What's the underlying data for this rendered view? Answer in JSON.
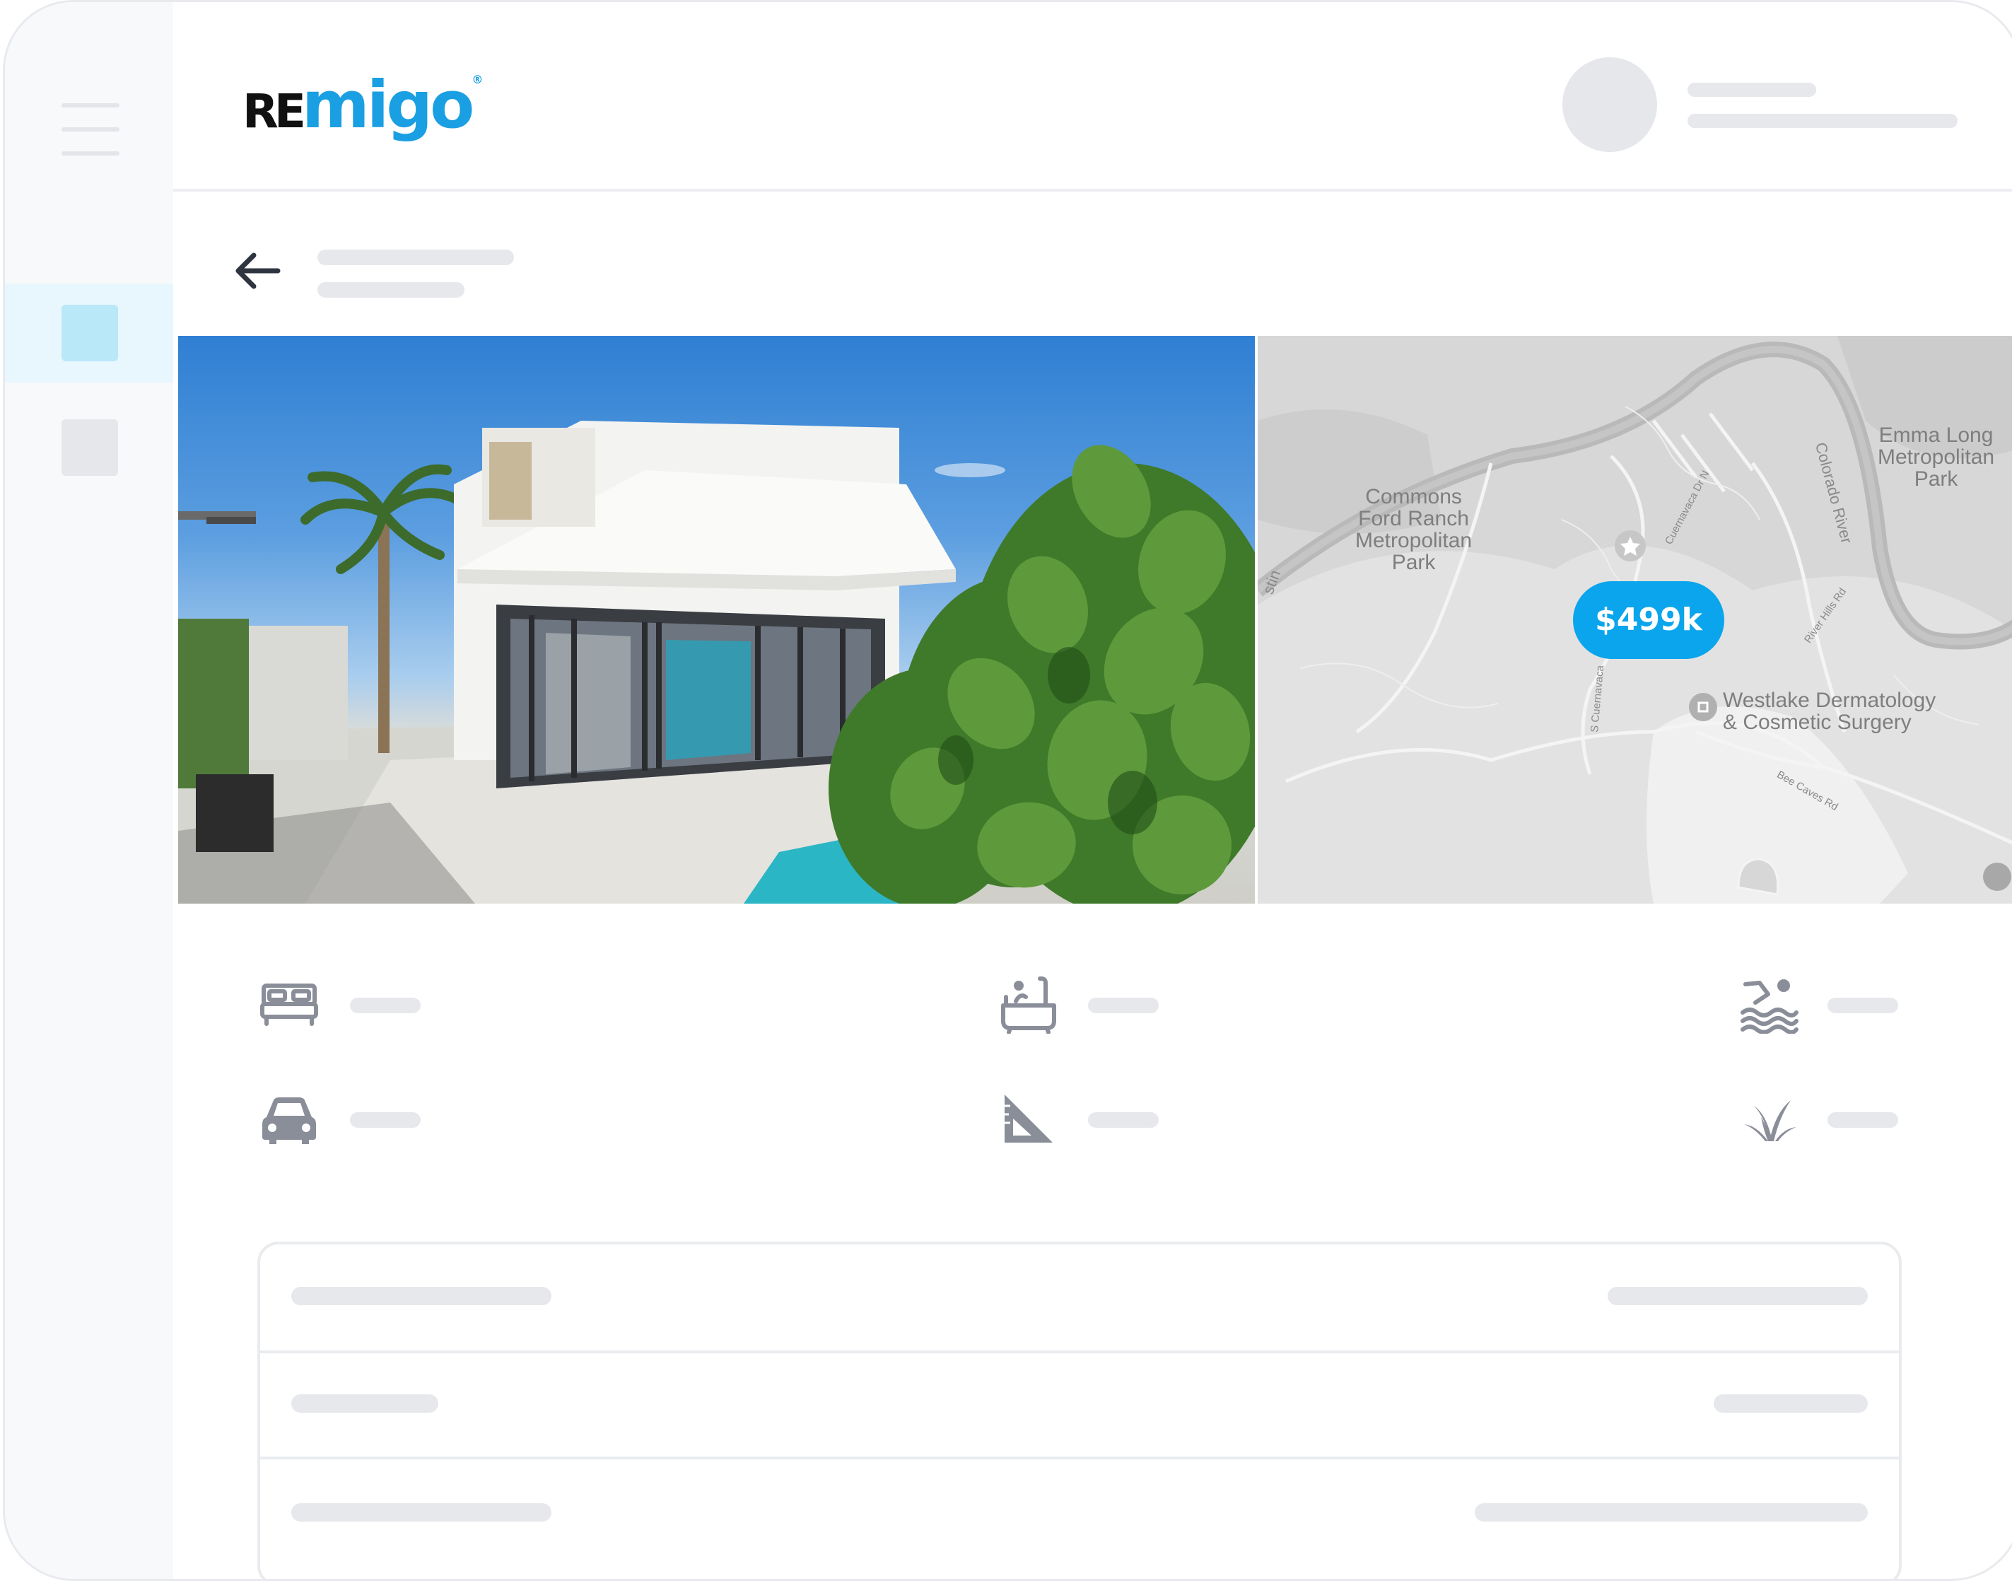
{
  "app": {
    "logo": {
      "part1": "RE",
      "part2": "migo",
      "mark": "®"
    }
  },
  "colors": {
    "brand_blue": "#1a9fe3",
    "price_pill": "#0aa5ec",
    "sidebar_active": "#e8f6fd",
    "sidebar_active_square": "#b9e8f8",
    "skeleton": "#e7e8ec",
    "icon_gray": "#8a8e99"
  },
  "sidebar": {
    "menu_icon": "hamburger-menu-icon",
    "items": [
      {
        "name": "sidebar-item-1",
        "active": true
      },
      {
        "name": "sidebar-item-2",
        "active": false
      }
    ]
  },
  "header": {
    "avatar": "user-avatar-placeholder"
  },
  "listing": {
    "back_icon": "arrow-left-icon",
    "photo": "house-exterior-photo",
    "price": "$499k"
  },
  "map": {
    "labels": {
      "park1": "Commons\nFord Ranch\nMetropolitan\nPark",
      "park2": "Emma Long\nMetropolitan\nPark",
      "clinic": "Westlake Dermatology\n& Cosmetic Surgery",
      "river": "Colorado River",
      "road1": "Cuernavaca Dr N",
      "road2": "S Cuernavaca",
      "road3": "River Hills Rd",
      "road4": "Bee Caves Rd",
      "edge": "stin"
    }
  },
  "features": [
    {
      "icon": "bed-icon"
    },
    {
      "icon": "bathtub-icon"
    },
    {
      "icon": "pool-swimmer-icon"
    },
    {
      "icon": "car-icon"
    },
    {
      "icon": "set-square-area-icon"
    },
    {
      "icon": "plant-yard-icon"
    }
  ]
}
